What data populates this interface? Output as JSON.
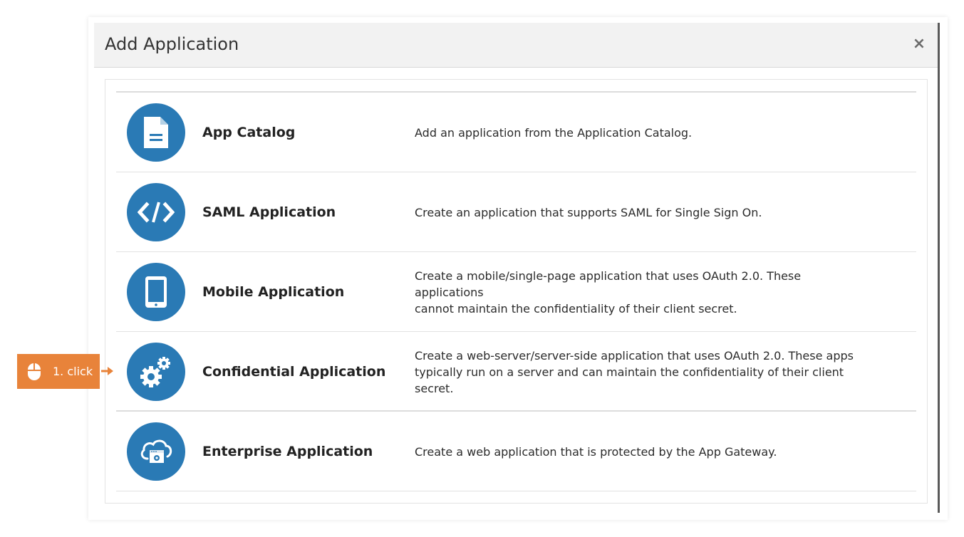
{
  "dialog": {
    "title": "Add Application",
    "close_label": "×"
  },
  "applications": [
    {
      "title": "App Catalog",
      "icon": "document-icon",
      "description_lines": [
        "Add an application from the Application Catalog."
      ]
    },
    {
      "title": "SAML Application",
      "icon": "code-icon",
      "description_lines": [
        "Create an application that supports SAML for Single Sign On."
      ]
    },
    {
      "title": "Mobile Application",
      "icon": "tablet-icon",
      "description_lines": [
        "Create a mobile/single-page application that uses OAuth 2.0. These applications",
        "cannot maintain the confidentiality of their client secret."
      ]
    },
    {
      "title": "Confidential Application",
      "icon": "gears-icon",
      "description_lines": [
        "Create a web-server/server-side application that uses OAuth 2.0. These apps",
        "typically run on a server and can maintain the confidentiality of their client secret."
      ]
    },
    {
      "title": "Enterprise Application",
      "icon": "cloud-gateway-icon",
      "description_lines": [
        "Create a web application that is protected by the App Gateway."
      ]
    }
  ],
  "callout": {
    "label": "1. click",
    "icon": "mouse-icon"
  },
  "colors": {
    "icon_circle": "#2a7ab5",
    "callout": "#e8833a",
    "header_bg": "#f2f2f2"
  }
}
